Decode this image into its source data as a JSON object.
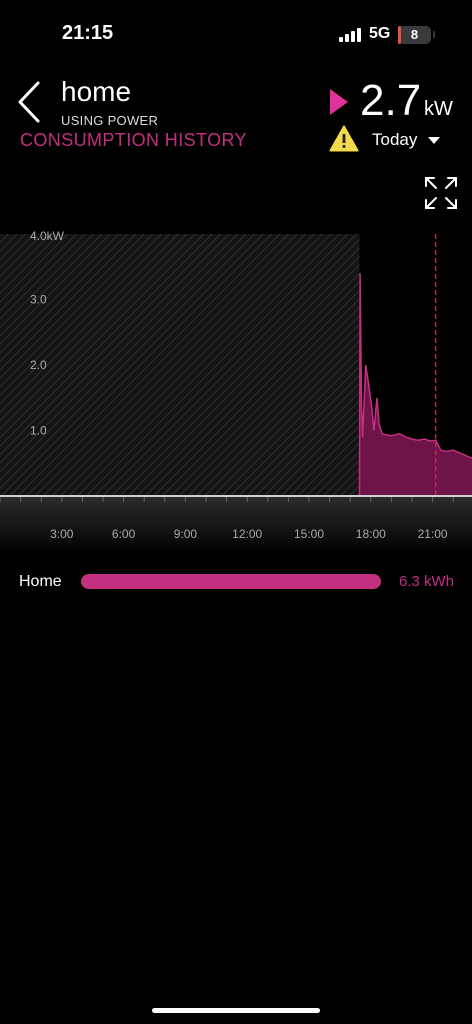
{
  "status_bar": {
    "time": "21:15",
    "network": "5G",
    "battery": "8",
    "battery_level": 0.08
  },
  "header": {
    "title": "home",
    "subtitle": "USING POWER",
    "section": "CONSUMPTION HISTORY",
    "power_value": "2.7",
    "power_unit": "kW",
    "period": "Today"
  },
  "colors": {
    "accent": "#c2307f",
    "warning": "#f2d94e",
    "background": "#000000"
  },
  "icons": [
    "back-chevron-icon",
    "play-indicator-icon",
    "warning-icon",
    "dropdown-caret-icon",
    "expand-icon"
  ],
  "chart_data": {
    "type": "area",
    "xlabel": "",
    "ylabel": "",
    "y_unit_label": "4.0kW",
    "ylim": [
      0,
      4
    ],
    "xlim": [
      "0:00",
      "23:55"
    ],
    "y_ticks": [
      "1.0",
      "2.0",
      "3.0"
    ],
    "x_ticks": [
      "3:00",
      "6:00",
      "9:00",
      "12:00",
      "15:00",
      "18:00",
      "21:00"
    ],
    "x_tick_hours": [
      3,
      6,
      9,
      12,
      15,
      18,
      21
    ],
    "no_data_until_hour": 17.45,
    "current_time_hour": 21.15,
    "series": [
      {
        "values": [
          {
            "x": 17.45,
            "y": 0.0
          },
          {
            "x": 17.48,
            "y": 3.4
          },
          {
            "x": 17.55,
            "y": 1.4
          },
          {
            "x": 17.6,
            "y": 0.9
          },
          {
            "x": 17.75,
            "y": 2.0
          },
          {
            "x": 17.9,
            "y": 1.7
          },
          {
            "x": 18.05,
            "y": 1.35
          },
          {
            "x": 18.15,
            "y": 1.0
          },
          {
            "x": 18.3,
            "y": 1.5
          },
          {
            "x": 18.4,
            "y": 1.1
          },
          {
            "x": 18.55,
            "y": 0.95
          },
          {
            "x": 19.0,
            "y": 0.92
          },
          {
            "x": 19.4,
            "y": 0.95
          },
          {
            "x": 19.7,
            "y": 0.9
          },
          {
            "x": 20.0,
            "y": 0.87
          },
          {
            "x": 20.3,
            "y": 0.85
          },
          {
            "x": 20.6,
            "y": 0.87
          },
          {
            "x": 20.9,
            "y": 0.84
          },
          {
            "x": 21.15,
            "y": 0.85
          },
          {
            "x": 21.4,
            "y": 0.7
          },
          {
            "x": 21.7,
            "y": 0.68
          },
          {
            "x": 22.0,
            "y": 0.7
          },
          {
            "x": 22.3,
            "y": 0.66
          },
          {
            "x": 22.6,
            "y": 0.62
          },
          {
            "x": 22.9,
            "y": 0.58
          },
          {
            "x": 23.3,
            "y": 0.5
          },
          {
            "x": 23.6,
            "y": 0.52
          },
          {
            "x": 23.95,
            "y": 0.5
          }
        ]
      }
    ]
  },
  "legend": {
    "name": "Home",
    "value": "6.3 kWh"
  }
}
